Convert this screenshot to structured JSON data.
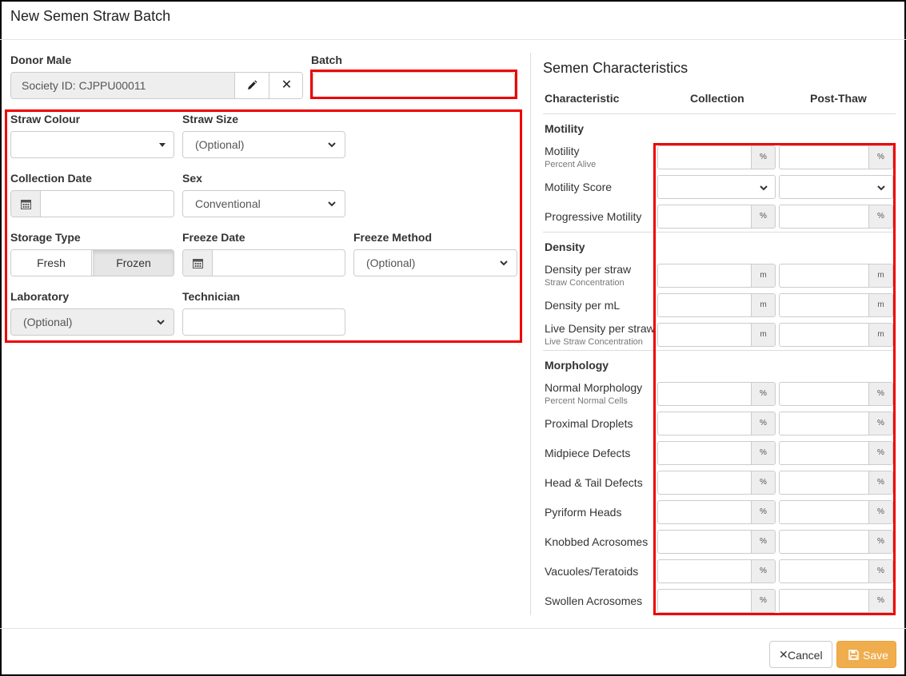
{
  "modal": {
    "title": "New Semen Straw Batch"
  },
  "form": {
    "donor_male": {
      "label": "Donor Male",
      "value": "Society ID: CJPPU00011"
    },
    "batch": {
      "label": "Batch",
      "value": ""
    },
    "straw_colour": {
      "label": "Straw Colour",
      "value": ""
    },
    "straw_size": {
      "label": "Straw Size",
      "value": "(Optional)"
    },
    "collection_date": {
      "label": "Collection Date",
      "value": ""
    },
    "sex": {
      "label": "Sex",
      "value": "Conventional"
    },
    "storage_type": {
      "label": "Storage Type",
      "options": [
        "Fresh",
        "Frozen"
      ],
      "selected": "Frozen"
    },
    "freeze_date": {
      "label": "Freeze Date",
      "value": ""
    },
    "freeze_method": {
      "label": "Freeze Method",
      "value": "(Optional)"
    },
    "laboratory": {
      "label": "Laboratory",
      "value": "(Optional)"
    },
    "technician": {
      "label": "Technician",
      "value": ""
    }
  },
  "characteristics": {
    "title": "Semen Characteristics",
    "columns": [
      "Characteristic",
      "Collection",
      "Post-Thaw"
    ],
    "sections": [
      {
        "name": "Motility",
        "rows": [
          {
            "label": "Motility",
            "sub": "Percent Alive",
            "unit": "%"
          },
          {
            "label": "Motility Score",
            "sub": "",
            "unit": ""
          },
          {
            "label": "Progressive Motility",
            "sub": "",
            "unit": "%"
          }
        ]
      },
      {
        "name": "Density",
        "rows": [
          {
            "label": "Density per straw",
            "sub": "Straw Concentration",
            "unit": "m"
          },
          {
            "label": "Density per mL",
            "sub": "",
            "unit": "m"
          },
          {
            "label": "Live Density per straw",
            "sub": "Live Straw Concentration",
            "unit": "m"
          }
        ]
      },
      {
        "name": "Morphology",
        "rows": [
          {
            "label": "Normal Morphology",
            "sub": "Percent Normal Cells",
            "unit": "%"
          },
          {
            "label": "Proximal Droplets",
            "sub": "",
            "unit": "%"
          },
          {
            "label": "Midpiece Defects",
            "sub": "",
            "unit": "%"
          },
          {
            "label": "Head & Tail Defects",
            "sub": "",
            "unit": "%"
          },
          {
            "label": "Pyriform Heads",
            "sub": "",
            "unit": "%"
          },
          {
            "label": "Knobbed Acrosomes",
            "sub": "",
            "unit": "%"
          },
          {
            "label": "Vacuoles/Teratoids",
            "sub": "",
            "unit": "%"
          },
          {
            "label": "Swollen Acrosomes",
            "sub": "",
            "unit": "%"
          }
        ]
      }
    ]
  },
  "footer": {
    "cancel_label": "Cancel",
    "save_label": "Save"
  },
  "colors": {
    "highlight": "#e00000",
    "save": "#f0ad4e"
  }
}
